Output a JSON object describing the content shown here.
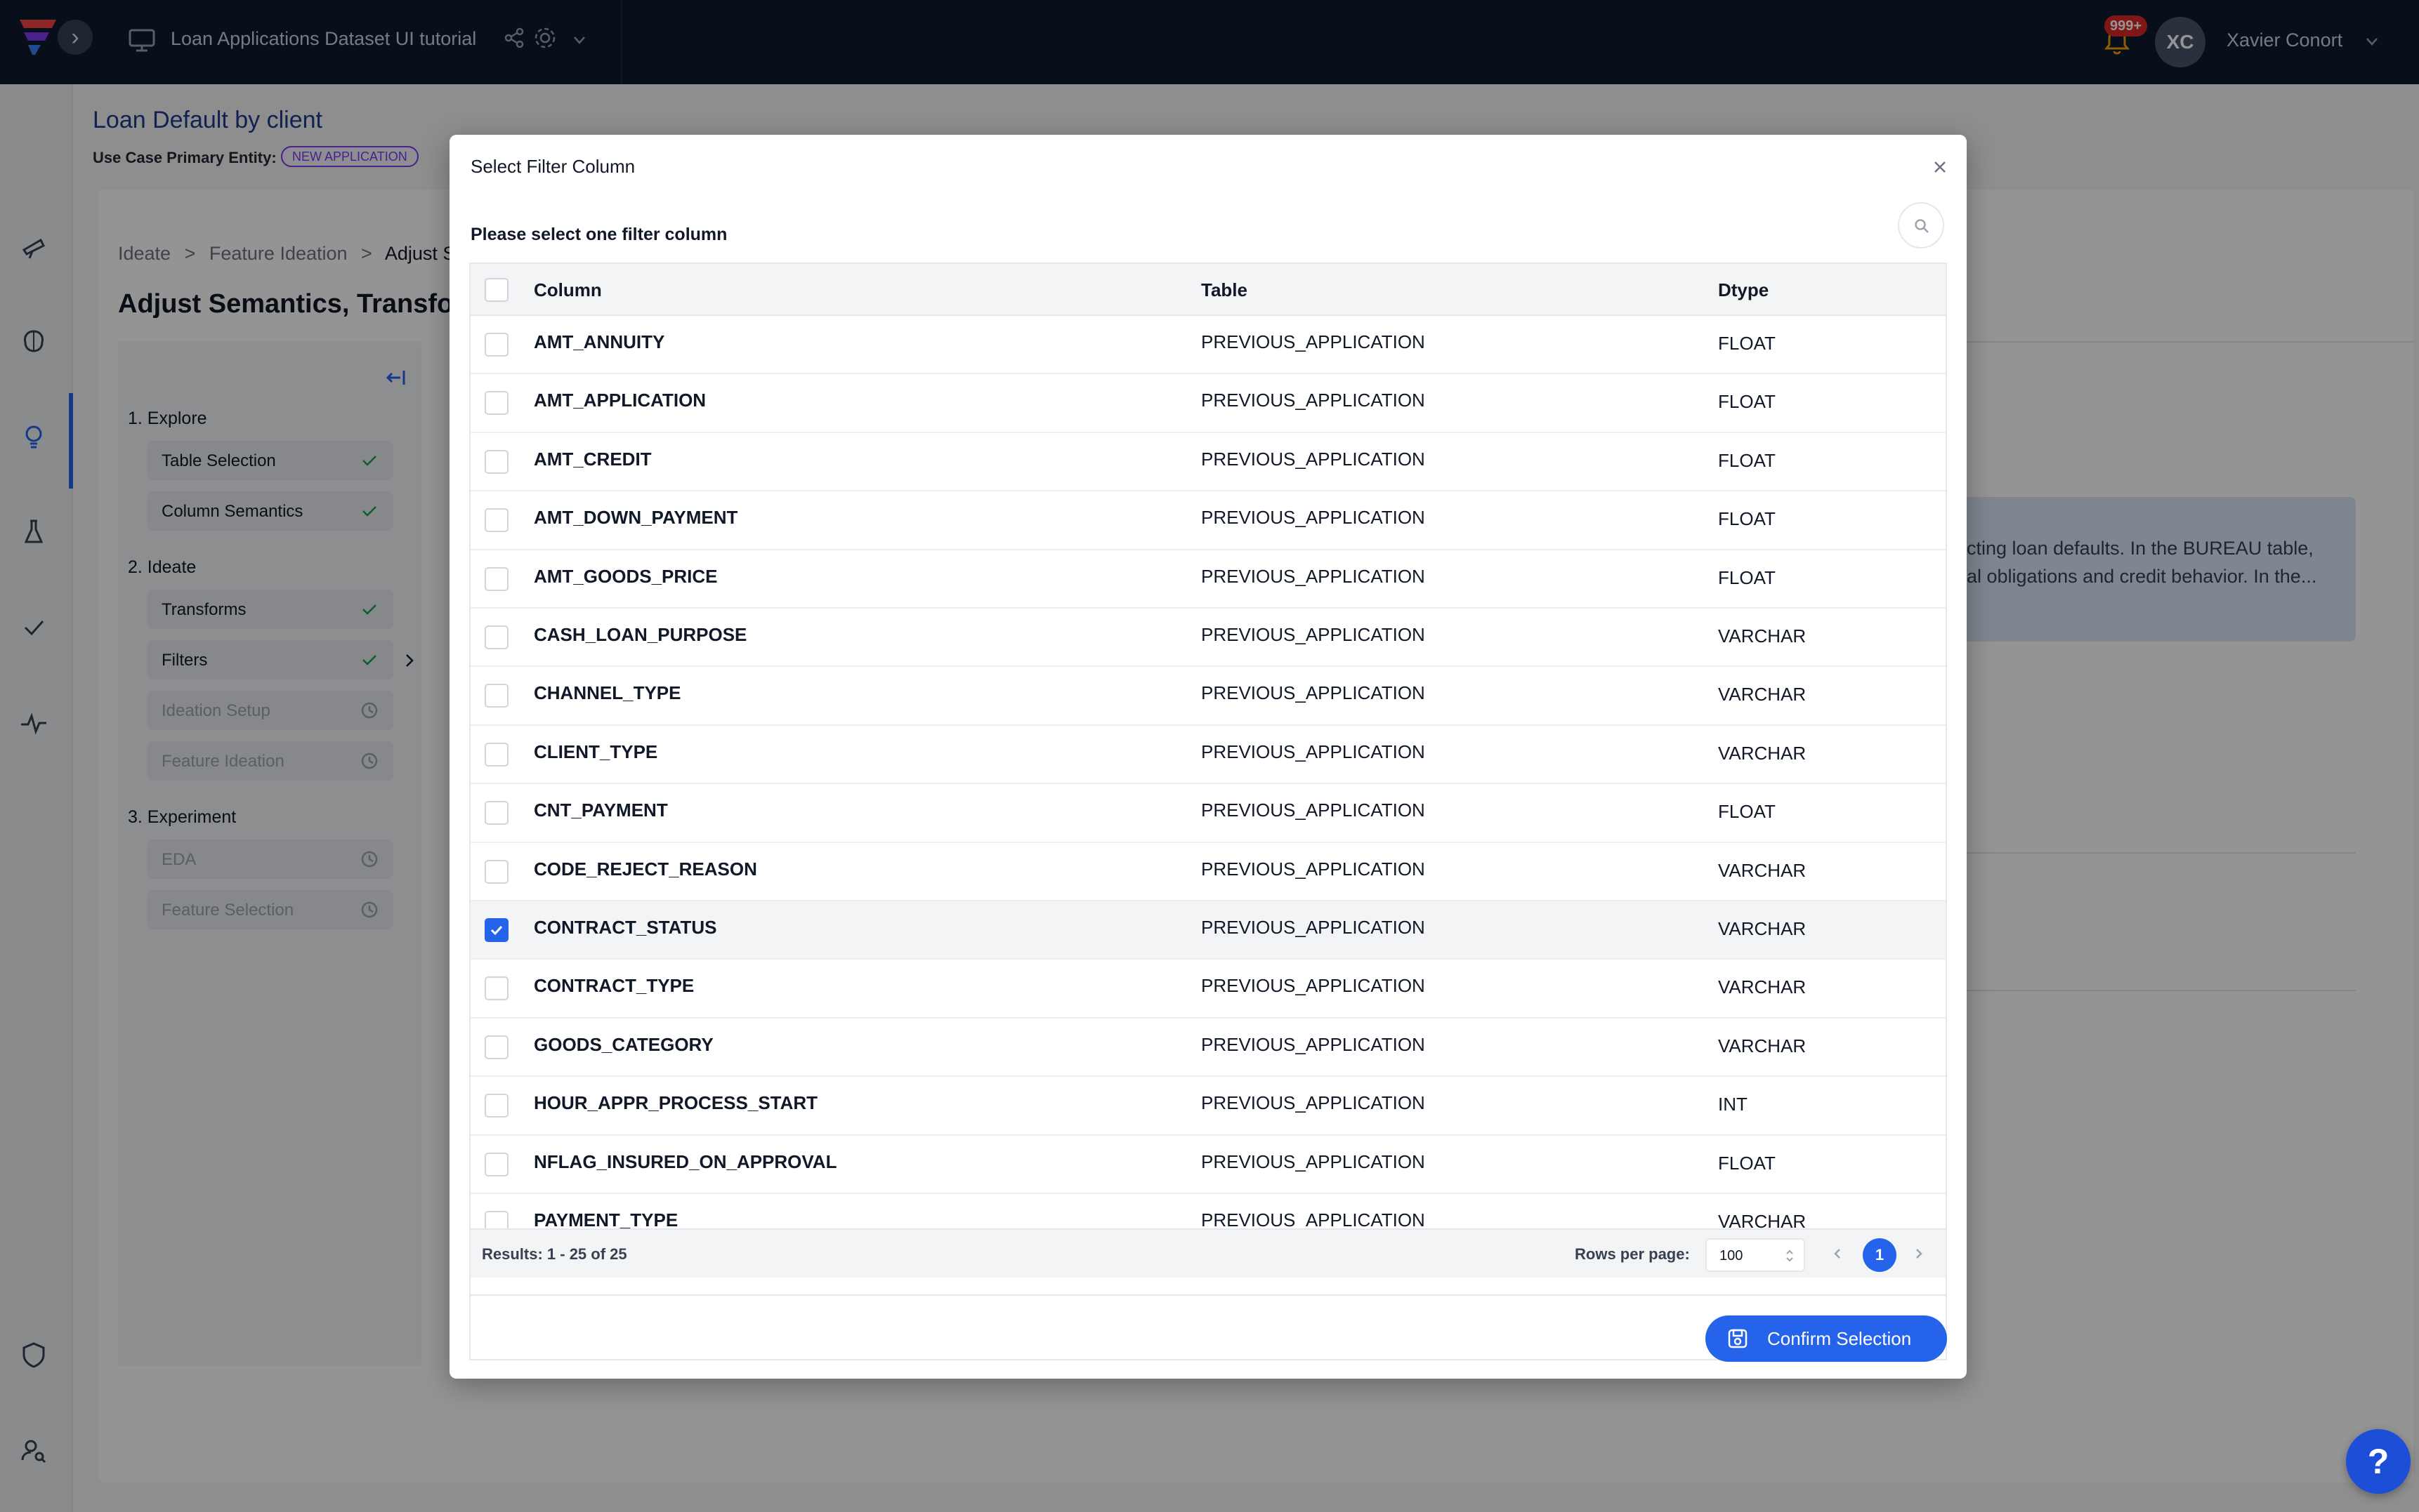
{
  "topbar": {
    "project_title": "Loan Applications Dataset UI tutorial",
    "notification_count": "999+",
    "user_initials": "XC",
    "user_name": "Xavier Conort"
  },
  "page": {
    "title": "Loan Default by client",
    "entity_label": "Use Case Primary Entity:",
    "entity_badge": "NEW APPLICATION",
    "breadcrumbs": [
      "Ideate",
      ">",
      "Feature Ideation",
      ">",
      "Adjust S"
    ],
    "section_title": "Adjust Semantics, Transfor",
    "info_lines": [
      "cting loan defaults. In the BUREAU table,",
      "al obligations and credit behavior. In the..."
    ]
  },
  "steps": {
    "groups": [
      {
        "label": "1. Explore"
      },
      {
        "label": "2. Ideate"
      },
      {
        "label": "3. Experiment"
      }
    ],
    "items": [
      {
        "label": "Table Selection",
        "status": "done"
      },
      {
        "label": "Column Semantics",
        "status": "done"
      },
      {
        "label": "Transforms",
        "status": "done"
      },
      {
        "label": "Filters",
        "status": "done"
      },
      {
        "label": "Ideation Setup",
        "status": "pending"
      },
      {
        "label": "Feature Ideation",
        "status": "pending"
      },
      {
        "label": "EDA",
        "status": "pending"
      },
      {
        "label": "Feature Selection",
        "status": "pending"
      }
    ]
  },
  "modal": {
    "title": "Select Filter Column",
    "subtitle": "Please select one filter column",
    "headers": {
      "column": "Column",
      "table": "Table",
      "dtype": "Dtype"
    },
    "rows": [
      {
        "column": "AMT_ANNUITY",
        "table": "PREVIOUS_APPLICATION",
        "dtype": "FLOAT",
        "checked": false
      },
      {
        "column": "AMT_APPLICATION",
        "table": "PREVIOUS_APPLICATION",
        "dtype": "FLOAT",
        "checked": false
      },
      {
        "column": "AMT_CREDIT",
        "table": "PREVIOUS_APPLICATION",
        "dtype": "FLOAT",
        "checked": false
      },
      {
        "column": "AMT_DOWN_PAYMENT",
        "table": "PREVIOUS_APPLICATION",
        "dtype": "FLOAT",
        "checked": false
      },
      {
        "column": "AMT_GOODS_PRICE",
        "table": "PREVIOUS_APPLICATION",
        "dtype": "FLOAT",
        "checked": false
      },
      {
        "column": "CASH_LOAN_PURPOSE",
        "table": "PREVIOUS_APPLICATION",
        "dtype": "VARCHAR",
        "checked": false
      },
      {
        "column": "CHANNEL_TYPE",
        "table": "PREVIOUS_APPLICATION",
        "dtype": "VARCHAR",
        "checked": false
      },
      {
        "column": "CLIENT_TYPE",
        "table": "PREVIOUS_APPLICATION",
        "dtype": "VARCHAR",
        "checked": false
      },
      {
        "column": "CNT_PAYMENT",
        "table": "PREVIOUS_APPLICATION",
        "dtype": "FLOAT",
        "checked": false
      },
      {
        "column": "CODE_REJECT_REASON",
        "table": "PREVIOUS_APPLICATION",
        "dtype": "VARCHAR",
        "checked": false
      },
      {
        "column": "CONTRACT_STATUS",
        "table": "PREVIOUS_APPLICATION",
        "dtype": "VARCHAR",
        "checked": true
      },
      {
        "column": "CONTRACT_TYPE",
        "table": "PREVIOUS_APPLICATION",
        "dtype": "VARCHAR",
        "checked": false
      },
      {
        "column": "GOODS_CATEGORY",
        "table": "PREVIOUS_APPLICATION",
        "dtype": "VARCHAR",
        "checked": false
      },
      {
        "column": "HOUR_APPR_PROCESS_START",
        "table": "PREVIOUS_APPLICATION",
        "dtype": "INT",
        "checked": false
      },
      {
        "column": "NFLAG_INSURED_ON_APPROVAL",
        "table": "PREVIOUS_APPLICATION",
        "dtype": "FLOAT",
        "checked": false
      },
      {
        "column": "PAYMENT_TYPE",
        "table": "PREVIOUS_APPLICATION",
        "dtype": "VARCHAR",
        "checked": false
      }
    ],
    "footer": {
      "results": "Results: 1 - 25 of 25",
      "rows_per_page_label": "Rows per page:",
      "rows_per_page_value": "100",
      "current_page": "1"
    },
    "confirm_label": "Confirm Selection"
  },
  "help_label": "?",
  "colors": {
    "accent": "#2563eb",
    "topbar": "#0f1b2e",
    "title": "#1e3a8a",
    "badge": "#7c3aed"
  }
}
